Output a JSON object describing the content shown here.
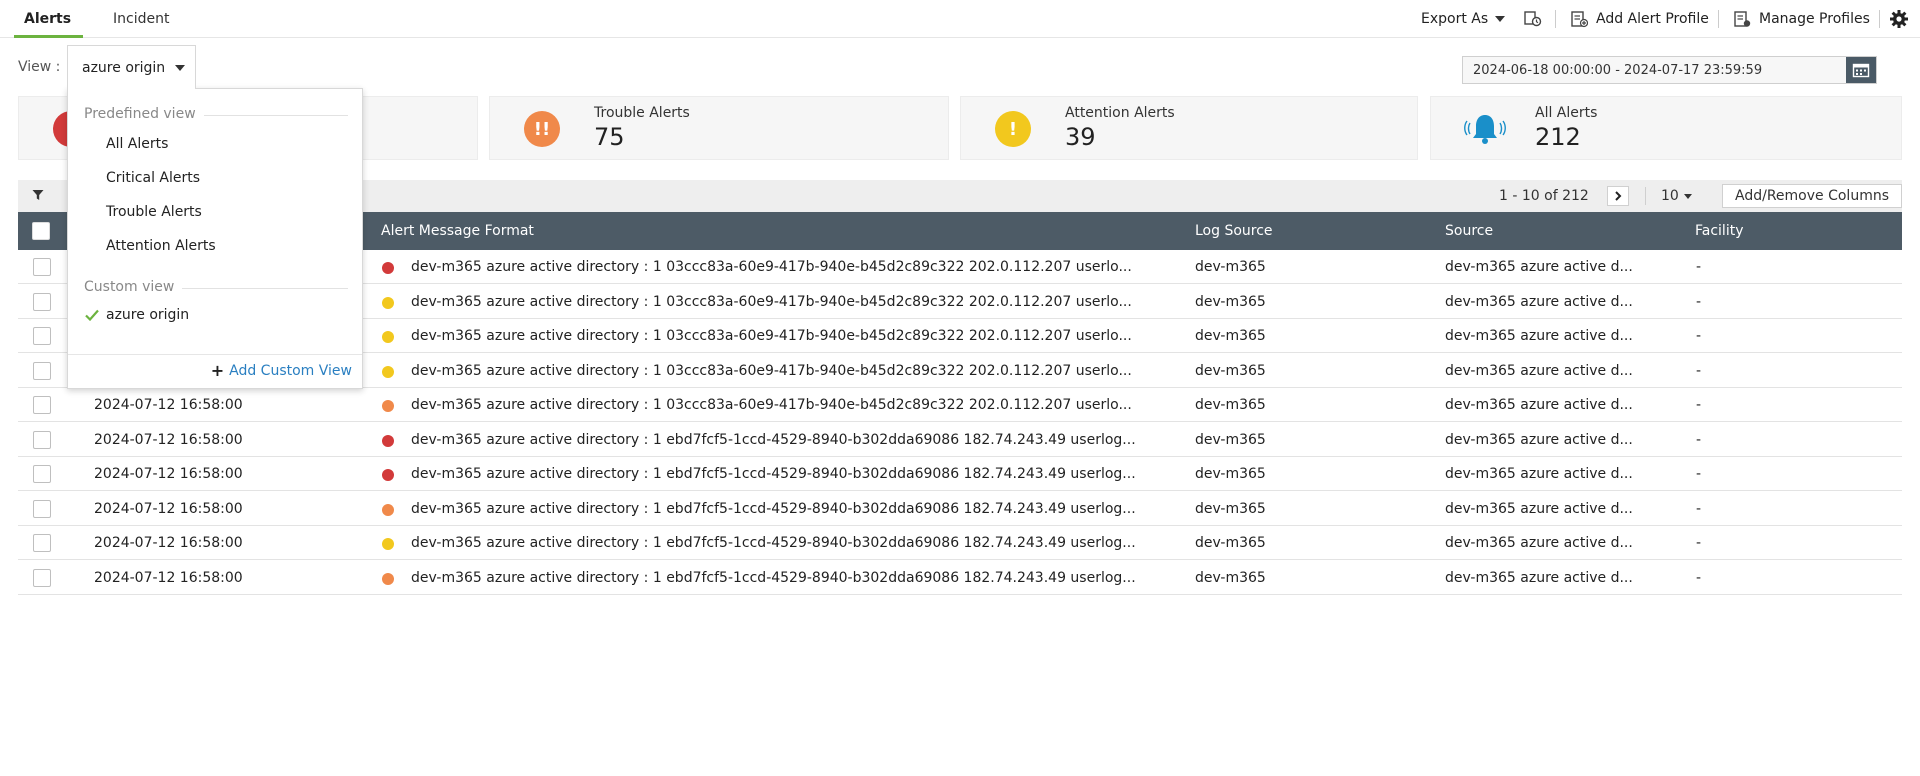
{
  "tabs": [
    {
      "label": "Alerts",
      "active": true
    },
    {
      "label": "Incident",
      "active": false
    }
  ],
  "toolbar": {
    "export_label": "Export As",
    "add_profile_label": "Add Alert Profile",
    "manage_profiles_label": "Manage Profiles"
  },
  "view": {
    "label": "View :",
    "selected": "azure origin"
  },
  "daterange": "2024-06-18 00:00:00 - 2024-07-17 23:59:59",
  "cards": [
    {
      "label": "Trouble Alerts",
      "value": "75",
      "color": "#f0894a",
      "icon": "double-exclamation-icon"
    },
    {
      "label": "Attention Alerts",
      "value": "39",
      "color": "#f2c81e",
      "icon": "exclamation-icon"
    },
    {
      "label": "All Alerts",
      "value": "212",
      "color": "#1a8fc9",
      "icon": "bell-icon"
    }
  ],
  "pager": {
    "range": "1 - 10 of 212",
    "page_size": "10",
    "add_remove_columns": "Add/Remove Columns"
  },
  "columns": {
    "message": "Alert Message Format",
    "log_source": "Log Source",
    "source": "Source",
    "facility": "Facility"
  },
  "colors": {
    "critical": "#d23a3a",
    "trouble": "#f0894a",
    "attention": "#f2c81e"
  },
  "rows": [
    {
      "time": "",
      "severity": "critical",
      "message": "dev-m365 azure active directory : 1 03ccc83a-60e9-417b-940e-b45d2c89c322 202.0.112.207 userlo...",
      "log_source": "dev-m365",
      "source": "dev-m365 azure active d...",
      "facility": "-"
    },
    {
      "time": "",
      "severity": "attention",
      "message": "dev-m365 azure active directory : 1 03ccc83a-60e9-417b-940e-b45d2c89c322 202.0.112.207 userlo...",
      "log_source": "dev-m365",
      "source": "dev-m365 azure active d...",
      "facility": "-"
    },
    {
      "time": "",
      "severity": "attention",
      "message": "dev-m365 azure active directory : 1 03ccc83a-60e9-417b-940e-b45d2c89c322 202.0.112.207 userlo...",
      "log_source": "dev-m365",
      "source": "dev-m365 azure active d...",
      "facility": "-"
    },
    {
      "time": "",
      "severity": "attention",
      "message": "dev-m365 azure active directory : 1 03ccc83a-60e9-417b-940e-b45d2c89c322 202.0.112.207 userlo...",
      "log_source": "dev-m365",
      "source": "dev-m365 azure active d...",
      "facility": "-"
    },
    {
      "time": "2024-07-12 16:58:00",
      "severity": "trouble",
      "message": "dev-m365 azure active directory : 1 03ccc83a-60e9-417b-940e-b45d2c89c322 202.0.112.207 userlo...",
      "log_source": "dev-m365",
      "source": "dev-m365 azure active d...",
      "facility": "-"
    },
    {
      "time": "2024-07-12 16:58:00",
      "severity": "critical",
      "message": "dev-m365 azure active directory : 1 ebd7fcf5-1ccd-4529-8940-b302dda69086 182.74.243.49 userlog...",
      "log_source": "dev-m365",
      "source": "dev-m365 azure active d...",
      "facility": "-"
    },
    {
      "time": "2024-07-12 16:58:00",
      "severity": "critical",
      "message": "dev-m365 azure active directory : 1 ebd7fcf5-1ccd-4529-8940-b302dda69086 182.74.243.49 userlog...",
      "log_source": "dev-m365",
      "source": "dev-m365 azure active d...",
      "facility": "-"
    },
    {
      "time": "2024-07-12 16:58:00",
      "severity": "trouble",
      "message": "dev-m365 azure active directory : 1 ebd7fcf5-1ccd-4529-8940-b302dda69086 182.74.243.49 userlog...",
      "log_source": "dev-m365",
      "source": "dev-m365 azure active d...",
      "facility": "-"
    },
    {
      "time": "2024-07-12 16:58:00",
      "severity": "attention",
      "message": "dev-m365 azure active directory : 1 ebd7fcf5-1ccd-4529-8940-b302dda69086 182.74.243.49 userlog...",
      "log_source": "dev-m365",
      "source": "dev-m365 azure active d...",
      "facility": "-"
    },
    {
      "time": "2024-07-12 16:58:00",
      "severity": "trouble",
      "message": "dev-m365 azure active directory : 1 ebd7fcf5-1ccd-4529-8940-b302dda69086 182.74.243.49 userlog...",
      "log_source": "dev-m365",
      "source": "dev-m365 azure active d...",
      "facility": "-"
    }
  ],
  "dropdown": {
    "predefined_title": "Predefined view",
    "predefined": [
      "All Alerts",
      "Critical Alerts",
      "Trouble Alerts",
      "Attention Alerts"
    ],
    "custom_title": "Custom view",
    "custom": [
      "azure origin"
    ],
    "add_custom": "Add Custom View"
  }
}
